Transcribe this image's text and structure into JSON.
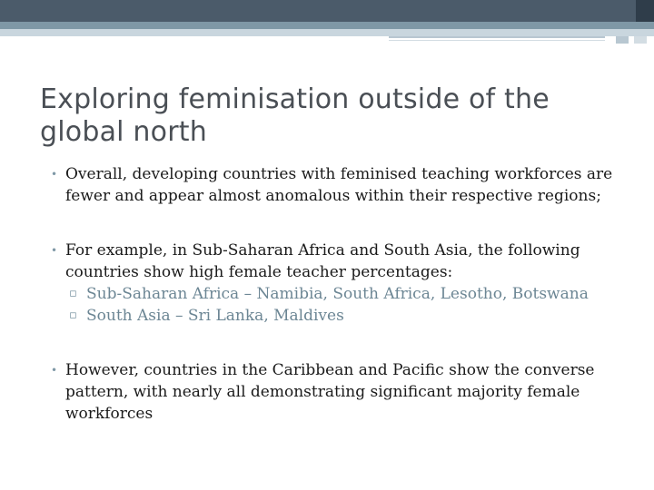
{
  "slide": {
    "title": "Exploring feminisation outside of the global north",
    "bullets": [
      {
        "text": "Overall, developing countries with feminised teaching workforces are fewer and appear almost anomalous within their respective regions;"
      },
      {
        "text": "For example, in Sub-Saharan Africa and South Asia, the following countries show high female teacher percentages:",
        "sub_items": [
          "Sub-Saharan Africa – Namibia, South Africa, Lesotho, Botswana",
          "South Asia – Sri Lanka, Maldives"
        ]
      },
      {
        "text": "However, countries in the Caribbean and Pacific show the converse pattern, with nearly all demonstrating significant majority female workforces"
      }
    ],
    "bullet_glyph": "•",
    "sub_bullet_glyph": "▫"
  },
  "colors": {
    "title": "#4a4f55",
    "body_text": "#1a1a1a",
    "sub_text": "#6c8694",
    "accent": "#7f98a6",
    "header_band": "#4b5b6a"
  }
}
